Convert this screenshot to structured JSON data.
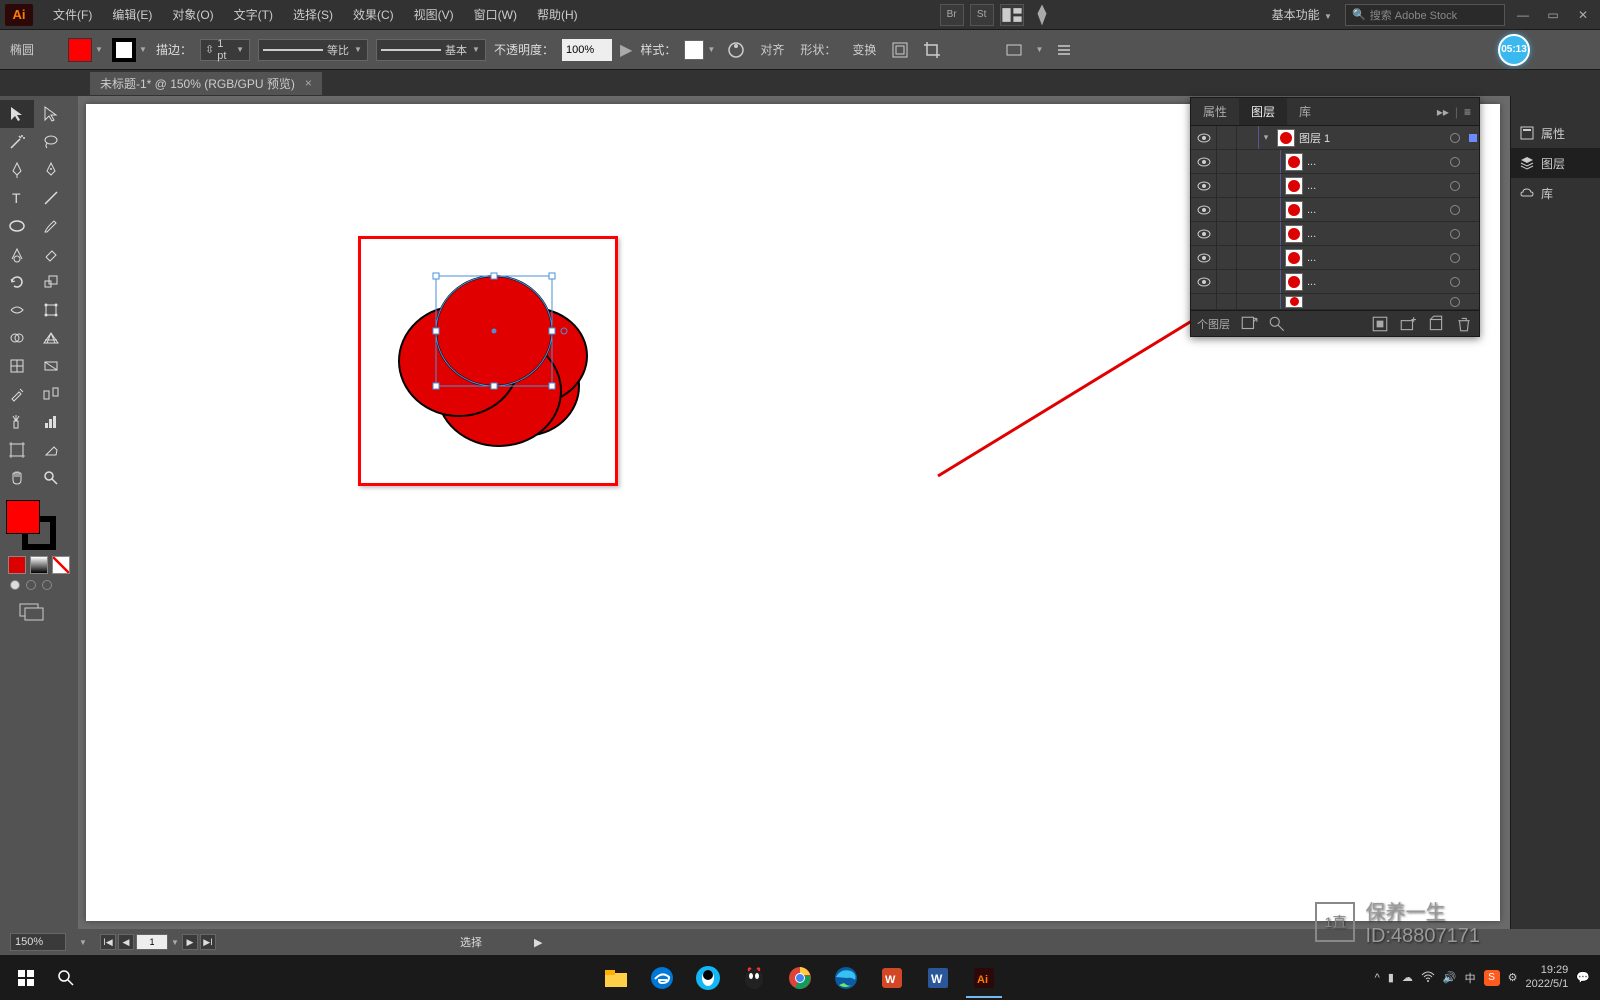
{
  "app_logo": "Ai",
  "menu": {
    "file": "文件(F)",
    "edit": "编辑(E)",
    "object": "对象(O)",
    "type": "文字(T)",
    "select": "选择(S)",
    "effect": "效果(C)",
    "view": "视图(V)",
    "window": "窗口(W)",
    "help": "帮助(H)"
  },
  "menubar_right": {
    "br": "Br",
    "st": "St",
    "workspace": "基本功能",
    "search_placeholder": "搜索 Adobe Stock"
  },
  "options": {
    "tool_name": "椭圆",
    "stroke_label": "描边：",
    "stroke_weight": "1 pt",
    "profile_label": "等比",
    "brush_label": "基本",
    "opacity_label": "不透明度：",
    "opacity_value": "100%",
    "style_label": "样式：",
    "align_label": "对齐",
    "shape_label": "形状：",
    "transform_label": "变换",
    "badge": "05:13"
  },
  "doctab": {
    "title": "未标题-1* @ 150% (RGB/GPU 预览)",
    "close": "×"
  },
  "layers_panel": {
    "tab_props": "属性",
    "tab_layers": "图层",
    "tab_libs": "库",
    "layer1_name": "图层 1",
    "sub_label": "...",
    "footer_count": "个图层"
  },
  "right_dock": {
    "props": "属性",
    "layers": "图层",
    "libs": "库"
  },
  "statusbar": {
    "zoom": "150%",
    "page": "1",
    "mode": "选择"
  },
  "tray": {
    "ime": "中",
    "time": "19:29",
    "date": "2022/5/1"
  },
  "watermark": {
    "line1": "保养一生",
    "line2": "ID:48807171"
  }
}
